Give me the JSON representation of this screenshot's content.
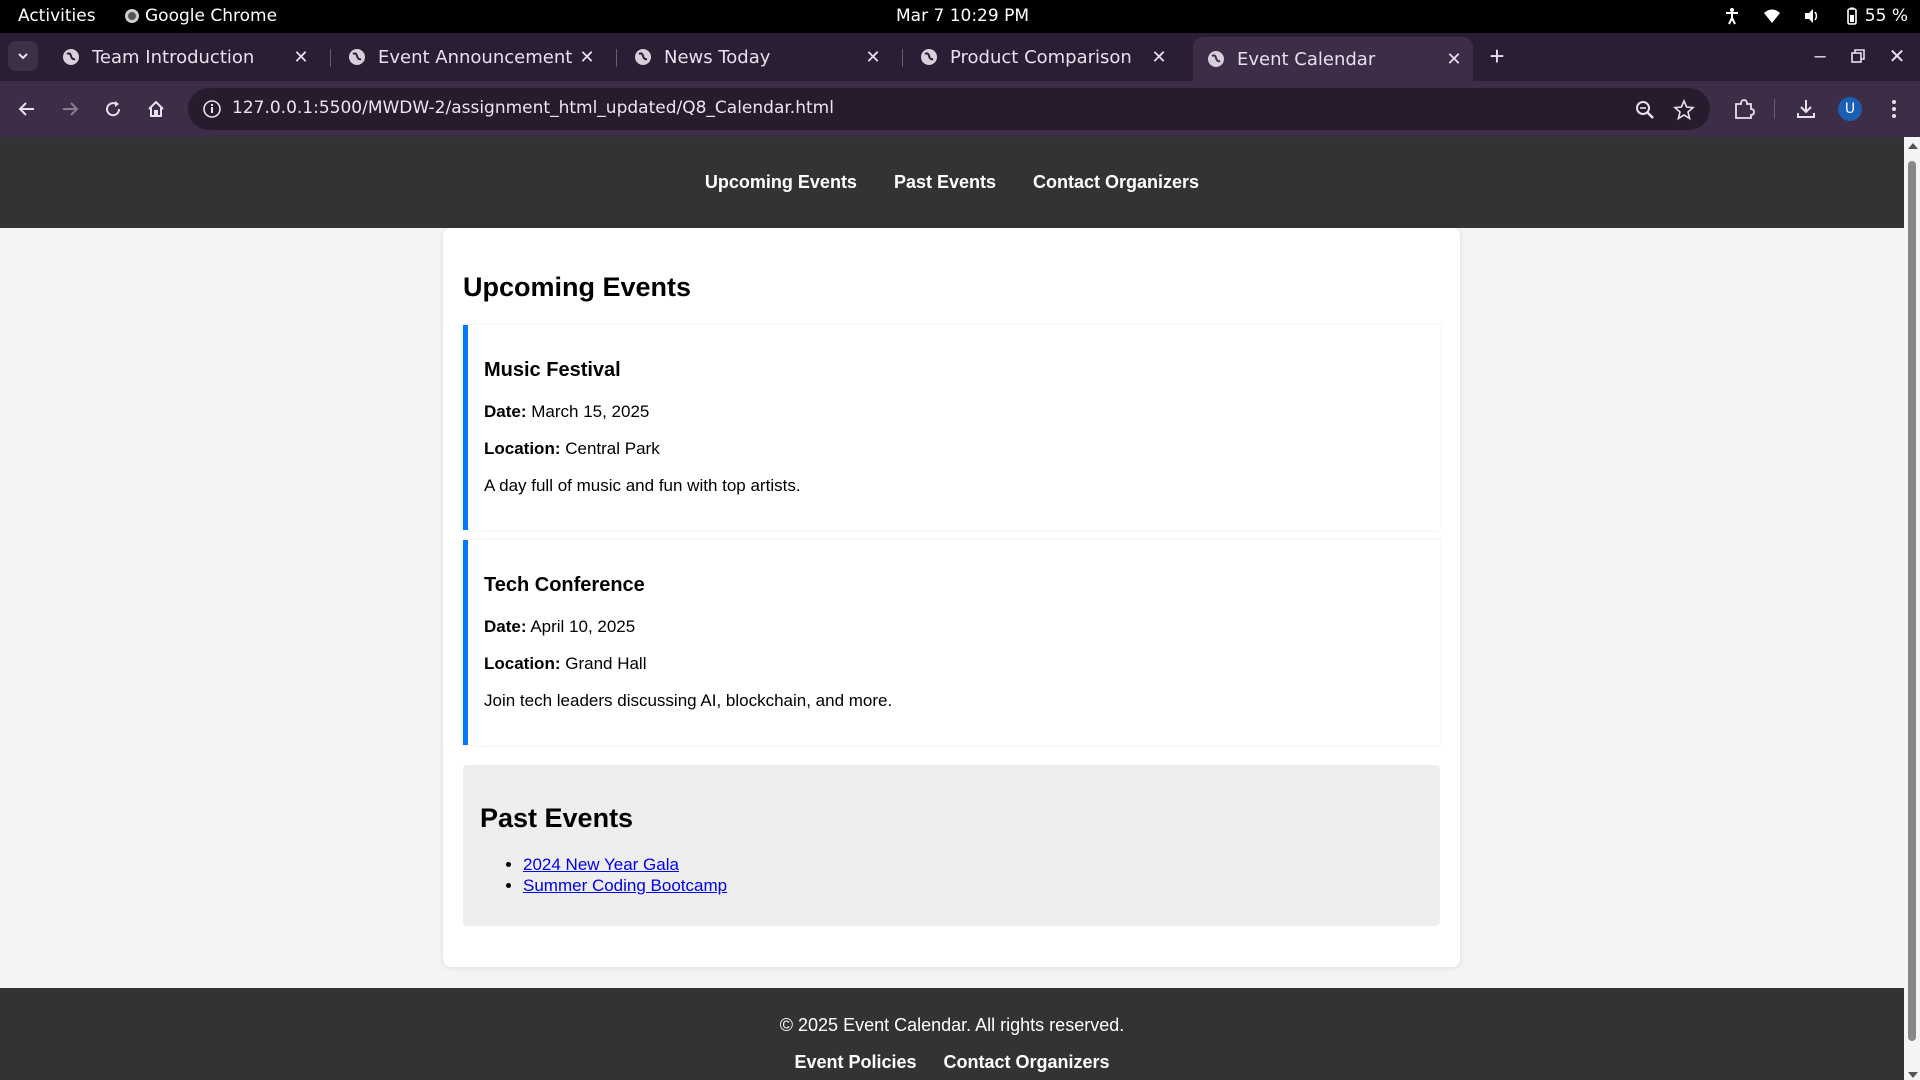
{
  "system_bar": {
    "activities": "Activities",
    "app_name": "Google Chrome",
    "clock": "Mar 7  10:29 PM",
    "battery": "55 %"
  },
  "browser": {
    "tabs": [
      {
        "title": "Team Introduction",
        "active": false
      },
      {
        "title": "Event Announcement",
        "active": false
      },
      {
        "title": "News Today",
        "active": false
      },
      {
        "title": "Product Comparison",
        "active": false
      },
      {
        "title": "Event Calendar",
        "active": true
      }
    ],
    "url": "127.0.0.1:5500/MWDW-2/assignment_html_updated/Q8_Calendar.html",
    "profile_initial": "U"
  },
  "page": {
    "nav": [
      "Upcoming Events",
      "Past Events",
      "Contact Organizers"
    ],
    "upcoming_heading": "Upcoming Events",
    "events": [
      {
        "title": "Music Festival",
        "date_label": "Date:",
        "date": "March 15, 2025",
        "location_label": "Location:",
        "location": "Central Park",
        "description": "A day full of music and fun with top artists."
      },
      {
        "title": "Tech Conference",
        "date_label": "Date:",
        "date": "April 10, 2025",
        "location_label": "Location:",
        "location": "Grand Hall",
        "description": "Join tech leaders discussing AI, blockchain, and more."
      }
    ],
    "past_heading": "Past Events",
    "past_events": [
      "2024 New Year Gala",
      "Summer Coding Bootcamp"
    ],
    "footer": {
      "copyright": "© 2025 Event Calendar. All rights reserved.",
      "links": [
        "Event Policies",
        "Contact Organizers"
      ]
    },
    "accent_color": "#007bff",
    "header_color": "#333333"
  }
}
